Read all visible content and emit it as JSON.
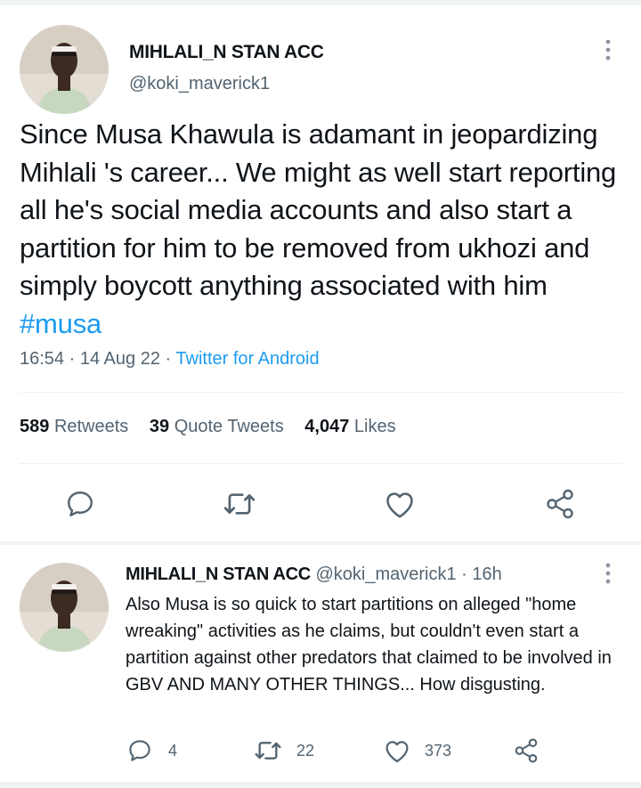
{
  "main_tweet": {
    "display_name": "MIHLALI_N STAN ACC",
    "handle": "@koki_maverick1",
    "text": "Since Musa Khawula is adamant in jeopardizing Mihlali 's career... We might as well start reporting all he's social media accounts and also start a partition for him to be removed from ukhozi and simply boycott anything associated with him ",
    "hashtag": "#musa",
    "time": "16:54",
    "date": "14 Aug 22",
    "source": "Twitter for Android",
    "stats": {
      "retweets_count": "589",
      "retweets_label": "Retweets",
      "quotes_count": "39",
      "quotes_label": "Quote Tweets",
      "likes_count": "4,047",
      "likes_label": "Likes"
    },
    "actions": [
      "reply-icon",
      "retweet-icon",
      "like-icon",
      "share-icon"
    ]
  },
  "reply_tweet": {
    "display_name": "MIHLALI_N STAN ACC",
    "handle": "@koki_maverick1",
    "age": "16h",
    "text": "Also Musa is so quick to start partitions on alleged \"home wreaking\" activities as he claims, but couldn't even start a partition against other predators that claimed to be involved in GBV AND MANY OTHER THINGS... How disgusting.",
    "reply_count": "4",
    "retweet_count": "22",
    "like_count": "373"
  },
  "colors": {
    "text": "#0f1419",
    "secondary": "#536471",
    "link": "#1d9bf0",
    "border": "#eff3f4"
  }
}
